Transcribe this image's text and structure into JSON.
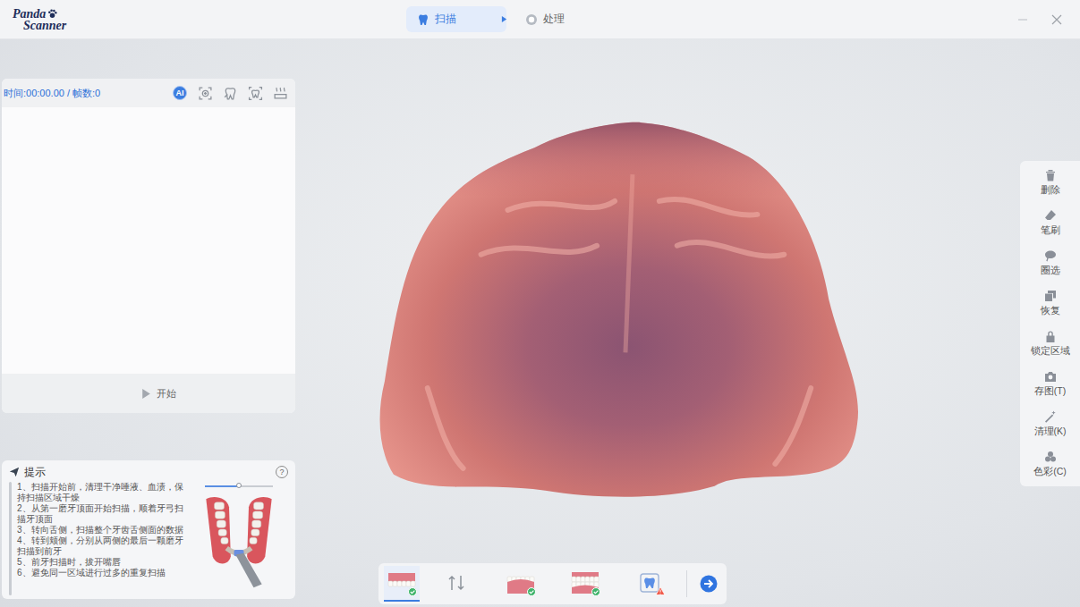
{
  "window": {
    "logo_line1": "Panda",
    "logo_line2": "Scanner"
  },
  "steps": [
    {
      "label": "扫描",
      "selected": true
    },
    {
      "label": "处理",
      "selected": false
    }
  ],
  "scan_panel": {
    "status": "时间:00:00.00 / 帧数:0",
    "tools": [
      {
        "label": "AI",
        "selected": true
      },
      {
        "label": "",
        "selected": false
      },
      {
        "label": "",
        "selected": false
      },
      {
        "label": "",
        "selected": false
      },
      {
        "label": "",
        "selected": false
      }
    ],
    "start_label": "开始"
  },
  "hints": {
    "title": "提示",
    "help": "?",
    "slider": {
      "level": 0.5
    },
    "items": [
      "1、扫描开始前，清理干净唾液、血渍，保持扫描区域干燥",
      "2、从第一磨牙顶面开始扫描，顺着牙弓扫描牙顶面",
      "3、转向舌侧，扫描整个牙齿舌侧面的数据",
      "4、转到颊侧，分别从两侧的最后一颗磨牙扫描到前牙",
      "5、前牙扫描时，拔开嘴唇",
      "6、避免同一区域进行过多的重复扫描"
    ]
  },
  "tools": [
    {
      "label": "删除"
    },
    {
      "label": "笔刷"
    },
    {
      "label": "圈选"
    },
    {
      "label": "恢复"
    },
    {
      "label": "锁定区域"
    },
    {
      "label": "存图(T)"
    },
    {
      "label": "清理(K)"
    },
    {
      "label": "色彩(C)"
    }
  ],
  "jaw_bar": {
    "items": [
      {
        "kind": "upper",
        "selected": true,
        "checked": true,
        "warning": false
      },
      {
        "kind": "swap",
        "selected": false,
        "checked": false,
        "warning": false
      },
      {
        "kind": "lower",
        "selected": false,
        "checked": true,
        "warning": false
      },
      {
        "kind": "bite",
        "selected": false,
        "checked": true,
        "warning": false
      },
      {
        "kind": "check",
        "selected": false,
        "checked": false,
        "warning": true
      }
    ]
  }
}
